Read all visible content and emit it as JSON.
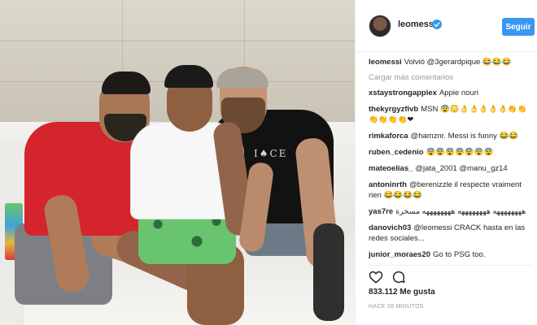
{
  "post": {
    "username": "leomessi",
    "follow_label": "Seguir",
    "caption_user": "leomessi",
    "caption_text": "Volvió @3gerardpique 😂😂😂",
    "load_more_label": "Cargar más comentarios",
    "photo_print_text": "I♠CE"
  },
  "comments": [
    {
      "user": "xstaystrongappiex",
      "text": "Appie nouri"
    },
    {
      "user": "thekyrgyzfivb",
      "text": "MSN 😨😳👌👌👌👌👌👏👏👏👏👏👏❤"
    },
    {
      "user": "rimkaforca",
      "text": "@hamznr. Messi is funny 😂😂"
    },
    {
      "user": "ruben_cedenio",
      "text": "😨😨😨😨😨😨😨"
    },
    {
      "user": "mateoelias_",
      "text": "@jata_2001 @manu_gz14"
    },
    {
      "user": "antoninrth",
      "text": "@berenizzle il respecte vraiment rien 😂😂😂😂"
    },
    {
      "user": "yas7re",
      "text": "ههههههههه ههههههههه ههههههههه مسخرة"
    },
    {
      "user": "danovich03",
      "text": "@leomessi CRACK hasta en las redes sociales..."
    },
    {
      "user": "junior_moraes20",
      "text": "Go to PSG too."
    }
  ],
  "footer": {
    "likes": "833.112 Me gusta",
    "timestamp": "HACE 28 MINUTOS"
  },
  "colors": {
    "accent": "#3897f0",
    "text": "#262626",
    "muted": "#999999"
  },
  "icons": [
    "verified-badge-icon",
    "heart-icon",
    "comment-icon"
  ]
}
